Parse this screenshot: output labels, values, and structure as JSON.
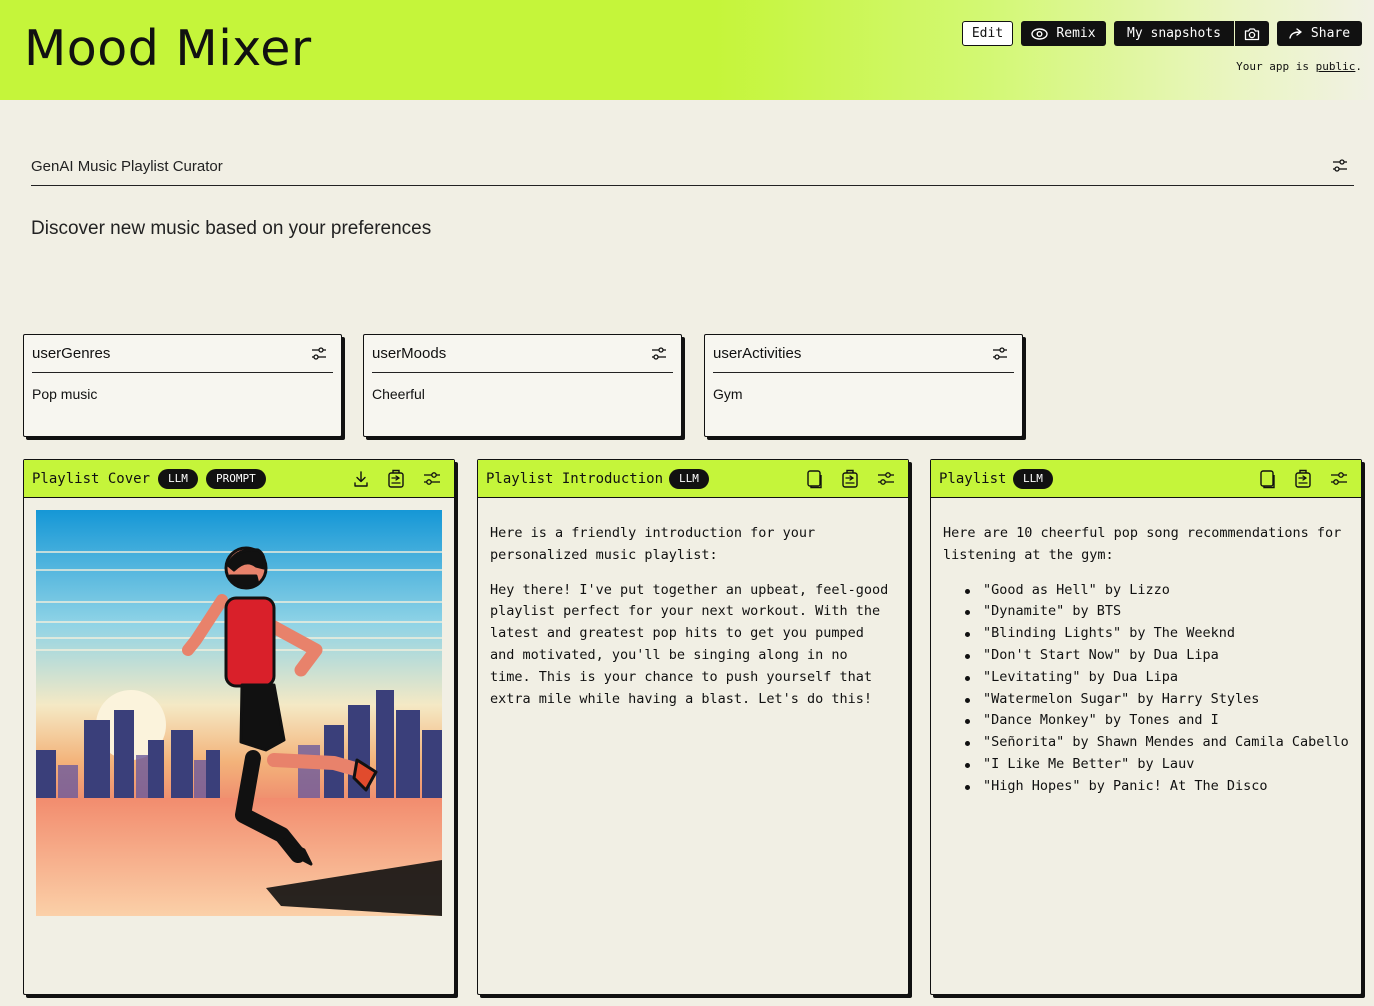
{
  "header": {
    "app_title": "Mood Mixer",
    "edit_label": "Edit",
    "remix_label": "Remix",
    "snapshots_label": "My snapshots",
    "share_label": "Share",
    "public_prefix": "Your app is",
    "public_link": "public",
    "public_suffix": ".",
    "accent_color": "#c5f53a"
  },
  "section": {
    "title": "GenAI Music Playlist Curator",
    "subtitle": "Discover new music based on your preferences"
  },
  "inputs": [
    {
      "label": "userGenres",
      "value": "Pop music"
    },
    {
      "label": "userMoods",
      "value": "Cheerful"
    },
    {
      "label": "userActivities",
      "value": "Gym"
    }
  ],
  "panels": {
    "cover": {
      "title": "Playlist Cover",
      "badges": [
        "LLM",
        "PROMPT"
      ]
    },
    "intro": {
      "title": "Playlist Introduction",
      "badges": [
        "LLM"
      ],
      "paragraphs": [
        "Here is a friendly introduction for your personalized music playlist:",
        "Hey there! I've put together an upbeat, feel-good playlist perfect for your next workout. With the latest and greatest pop hits to get you pumped and motivated, you'll be singing along in no time. This is your chance to push yourself that extra mile while having a blast. Let's do this!"
      ]
    },
    "playlist": {
      "title": "Playlist",
      "badges": [
        "LLM"
      ],
      "intro": "Here are 10 cheerful pop song recommendations for listening at the gym:",
      "songs": [
        "\"Good as Hell\" by Lizzo",
        "\"Dynamite\" by BTS",
        "\"Blinding Lights\" by The Weeknd",
        "\"Don't Start Now\" by Dua Lipa",
        "\"Levitating\" by Dua Lipa",
        "\"Watermelon Sugar\" by Harry Styles",
        "\"Dance Monkey\" by Tones and I",
        "\"Señorita\" by Shawn Mendes and Camila Cabello",
        "\"I Like Me Better\" by Lauv",
        "\"High Hopes\" by Panic! At The Disco"
      ]
    }
  },
  "icons": {
    "settings": "sliders-icon",
    "download": "download-icon",
    "copy": "copy-icon",
    "export": "export-icon",
    "remix": "eye-icon",
    "camera": "camera-icon",
    "share": "arrow-right-icon"
  }
}
